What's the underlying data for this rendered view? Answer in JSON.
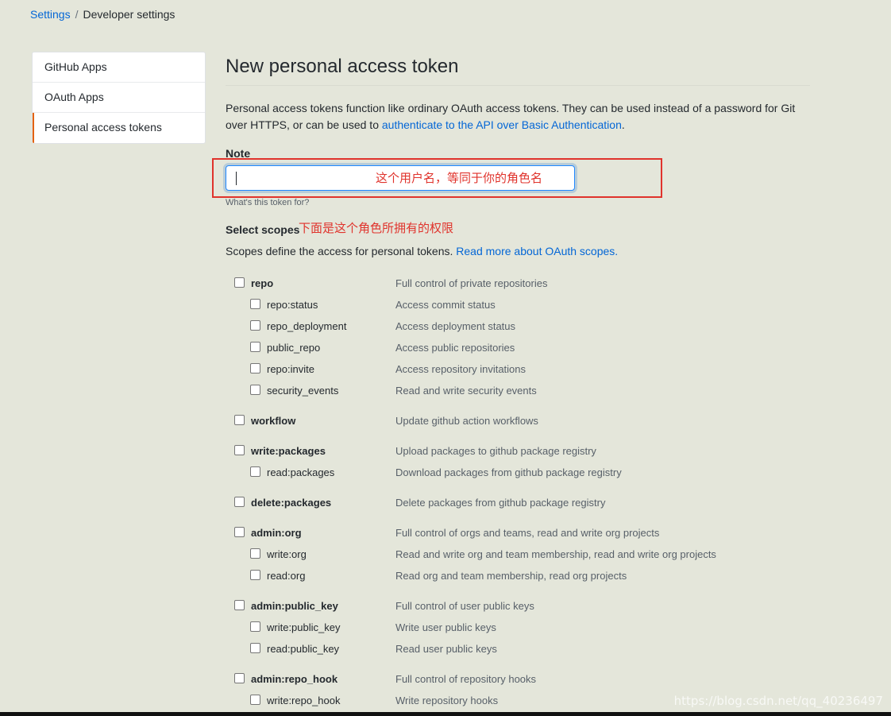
{
  "breadcrumb": {
    "root": "Settings",
    "separator": "/",
    "current": "Developer settings"
  },
  "sidebar": {
    "items": [
      {
        "label": "GitHub Apps"
      },
      {
        "label": "OAuth Apps"
      },
      {
        "label": "Personal access tokens"
      }
    ]
  },
  "page": {
    "title": "New personal access token",
    "intro_text": "Personal access tokens function like ordinary OAuth access tokens. They can be used instead of a password for Git over HTTPS, or can be used to ",
    "intro_link": "authenticate to the API over Basic Authentication",
    "intro_end": "."
  },
  "note": {
    "label": "Note",
    "value": "",
    "hint": "What's this token for?"
  },
  "annotations": {
    "note_callout": "这个用户名，等同于你的角色名",
    "scopes_callout": "下面是这个角色所拥有的权限",
    "color": "#e0332c"
  },
  "scopes": {
    "label": "Select scopes",
    "desc": "Scopes define the access for personal tokens. ",
    "desc_link": "Read more about OAuth scopes.",
    "items": [
      {
        "name": "repo",
        "desc": "Full control of private repositories"
      },
      {
        "name": "repo:status",
        "desc": "Access commit status"
      },
      {
        "name": "repo_deployment",
        "desc": "Access deployment status"
      },
      {
        "name": "public_repo",
        "desc": "Access public repositories"
      },
      {
        "name": "repo:invite",
        "desc": "Access repository invitations"
      },
      {
        "name": "security_events",
        "desc": "Read and write security events"
      },
      {
        "name": "workflow",
        "desc": "Update github action workflows"
      },
      {
        "name": "write:packages",
        "desc": "Upload packages to github package registry"
      },
      {
        "name": "read:packages",
        "desc": "Download packages from github package registry"
      },
      {
        "name": "delete:packages",
        "desc": "Delete packages from github package registry"
      },
      {
        "name": "admin:org",
        "desc": "Full control of orgs and teams, read and write org projects"
      },
      {
        "name": "write:org",
        "desc": "Read and write org and team membership, read and write org projects"
      },
      {
        "name": "read:org",
        "desc": "Read org and team membership, read org projects"
      },
      {
        "name": "admin:public_key",
        "desc": "Full control of user public keys"
      },
      {
        "name": "write:public_key",
        "desc": "Write user public keys"
      },
      {
        "name": "read:public_key",
        "desc": "Read user public keys"
      },
      {
        "name": "admin:repo_hook",
        "desc": "Full control of repository hooks"
      },
      {
        "name": "write:repo_hook",
        "desc": "Write repository hooks"
      }
    ]
  },
  "watermark": "https://blog.csdn.net/qq_40236497",
  "colors": {
    "link": "#0366d6",
    "accent": "#e36209",
    "background": "#e4e6da"
  }
}
